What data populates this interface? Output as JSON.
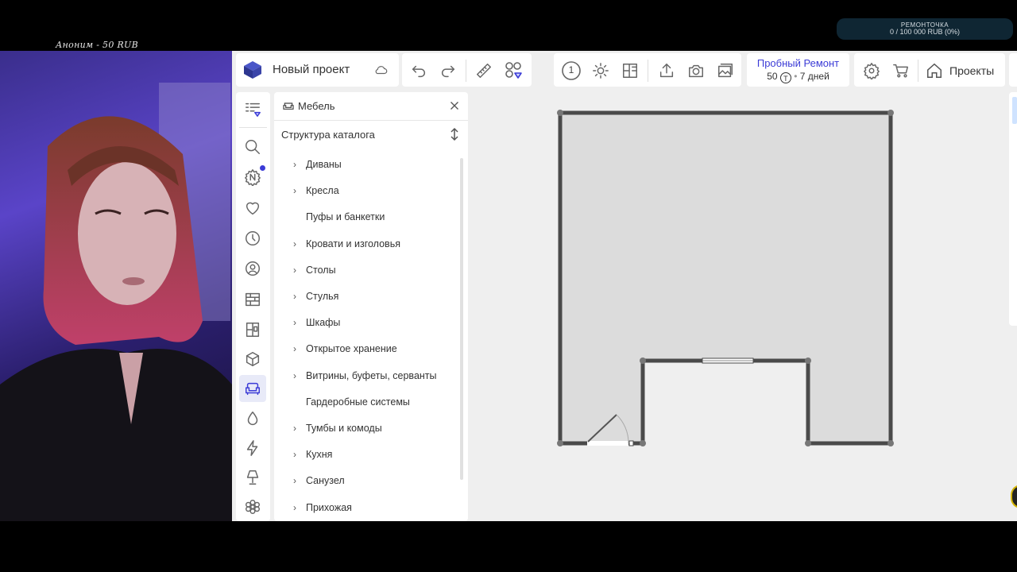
{
  "stream": {
    "donation_text": "Аноним - 50 RUB",
    "goal_title": "РЕМОНТОЧКА",
    "goal_value": "0 / 100 000 RUB (0%)"
  },
  "header": {
    "project_name": "Новый проект",
    "trial_title": "Пробный Ремонт",
    "trial_amount": "50",
    "trial_days": "7 дней",
    "projects_label": "Проекты",
    "floor_number": "1"
  },
  "catalog": {
    "panel_title": "Мебель",
    "section_title": "Структура каталога",
    "items": [
      {
        "label": "Диваны",
        "expandable": true
      },
      {
        "label": "Кресла",
        "expandable": true
      },
      {
        "label": "Пуфы и банкетки",
        "expandable": false
      },
      {
        "label": "Кровати и изголовья",
        "expandable": true
      },
      {
        "label": "Столы",
        "expandable": true
      },
      {
        "label": "Стулья",
        "expandable": true
      },
      {
        "label": "Шкафы",
        "expandable": true
      },
      {
        "label": "Открытое хранение",
        "expandable": true
      },
      {
        "label": "Витрины, буфеты, серванты",
        "expandable": true
      },
      {
        "label": "Гардеробные системы",
        "expandable": false
      },
      {
        "label": "Тумбы и комоды",
        "expandable": true
      },
      {
        "label": "Кухня",
        "expandable": true
      },
      {
        "label": "Санузел",
        "expandable": true
      },
      {
        "label": "Прихожая",
        "expandable": true
      }
    ]
  },
  "colors": {
    "accent": "#3b3bd6",
    "logo": "#4a56c8",
    "wall": "#4a4a4a",
    "floor": "#dcdcdc",
    "canvas": "#efefef"
  }
}
